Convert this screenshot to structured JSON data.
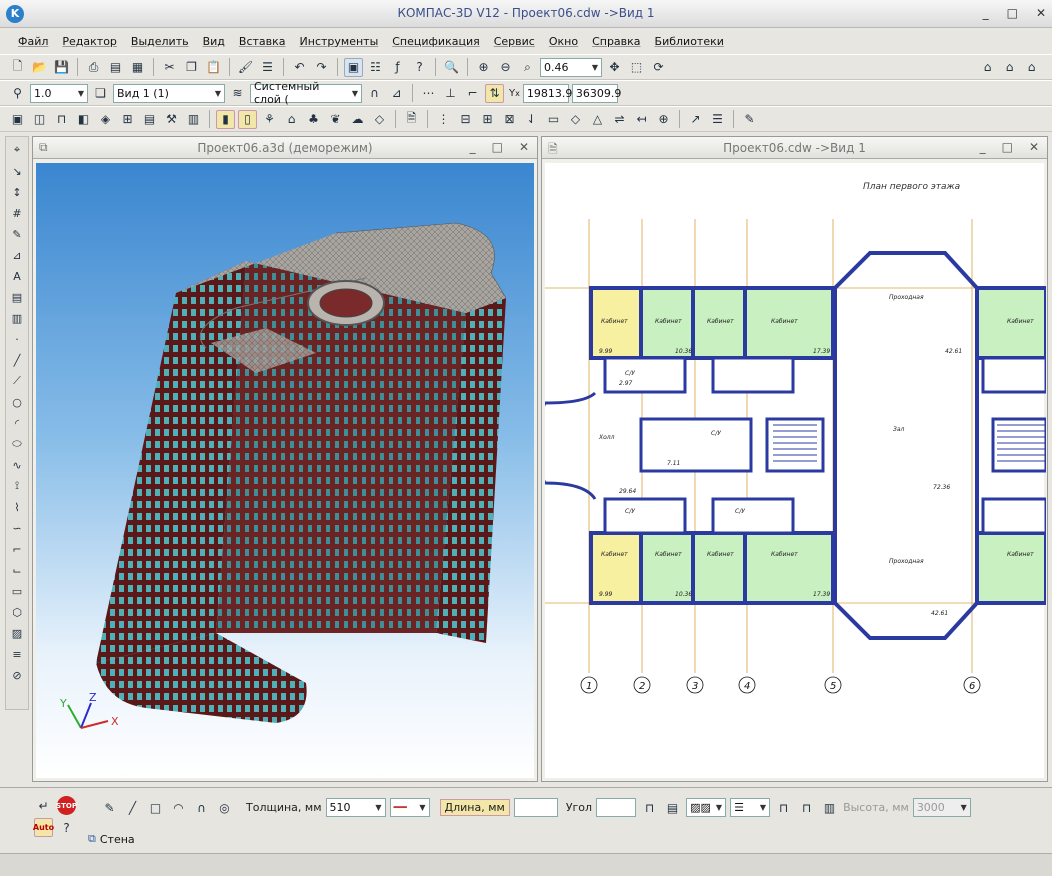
{
  "app": {
    "title": "КОМПАС-3D V12 - Проект06.cdw ->Вид 1",
    "logo": "K"
  },
  "window_buttons": {
    "minimize": "_",
    "restore": "□",
    "close": "✕"
  },
  "menu": [
    "Файл",
    "Редактор",
    "Выделить",
    "Вид",
    "Вставка",
    "Инструменты",
    "Спецификация",
    "Сервис",
    "Окно",
    "Справка",
    "Библиотеки"
  ],
  "toolbar1": {
    "zoom": "0.46"
  },
  "toolbar2": {
    "scale": "1.0",
    "view": "Вид 1 (1)",
    "layer": "Системный слой (",
    "coord_x": "19813.9",
    "coord_y": "36309.9",
    "y_label": "Y",
    "x_label": "x"
  },
  "panel3d": {
    "title": "Проект06.a3d (деморежим)",
    "axes": {
      "x": "X",
      "y": "Y",
      "z": "Z"
    }
  },
  "panel2d": {
    "title": "Проект06.cdw ->Вид 1",
    "drawing": {
      "plan_title": "План первого этажа",
      "room_office": "Кабинет",
      "room_passage": "Проходная",
      "room_hall": "Холл",
      "room_zal": "Зал",
      "room_su": "С/У",
      "area_a": "9.99",
      "area_b": "10.36",
      "area_c": "17.39",
      "area_d": "2.97",
      "area_e": "7.11",
      "area_f": "42.61",
      "area_g": "29.64",
      "area_h": "72.36",
      "axes": [
        "1",
        "2",
        "3",
        "4",
        "5",
        "6"
      ]
    }
  },
  "bottom": {
    "thickness_label": "Толщина, мм",
    "thickness": "510",
    "length_label": "Длина, мм",
    "length": "",
    "angle_label": "Угол",
    "angle": "",
    "height_label": "Высота, мм",
    "height": "3000",
    "auto": "Auto",
    "stop": "STOP",
    "help": "?"
  },
  "status": {
    "tag": "Стена"
  },
  "colors": {
    "green": "#c8f0c0",
    "yellow": "#f7f0a0",
    "wall": "#2a3aa0"
  }
}
